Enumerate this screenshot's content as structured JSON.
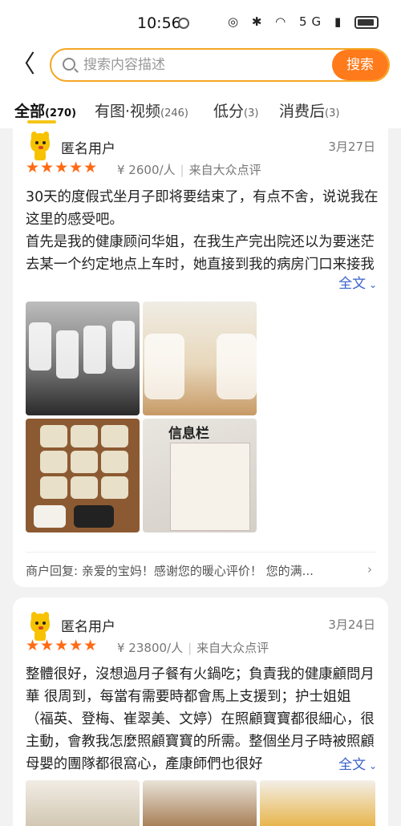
{
  "status": {
    "time": "10:56",
    "icons": "◎ ✱ ◠ 5G ▮"
  },
  "header": {
    "search_placeholder": "搜索内容描述",
    "search_button": "搜索",
    "back_glyph": "〈"
  },
  "tabs": [
    {
      "label": "全部",
      "count": "(270)"
    },
    {
      "label": "有图·视频",
      "count": "(246)"
    },
    {
      "label": "低分",
      "count": "(3)"
    },
    {
      "label": "消费后",
      "count": "(3)"
    }
  ],
  "reviews": [
    {
      "user": "匿名用户",
      "date": "3月27日",
      "stars": "★★★★★",
      "price": "¥ 2600/人",
      "source": "来自大众点评",
      "text": "30天的度假式坐月子即将要结束了，有点不舍，说说我在这里的感受吧。\n首先是我的健康顾问华姐，在我生产完出院还以为要迷茫去某一个约定地点上车时，她直接到我的病房门口来接我了，被惊喜到了。偶尔送餐来我房间还会给",
      "more": "全文",
      "photo_text": "信息栏",
      "reply": "商户回复: 亲爱的宝妈！感谢您的暖心评价！ 您的满..."
    },
    {
      "user": "匿名用户",
      "date": "3月24日",
      "stars": "★★★★★",
      "price": "¥ 23800/人",
      "source": "来自大众点评",
      "text": "整體很好，沒想過月子餐有火鍋吃；負責我的健康顧問月華 很周到，每當有需要時都會馬上支援到；护士姐姐（福英、登梅、崔翠美、文婷）在照顧寶寶都很細心，很主動，會教我怎麼照顧寶寶的所需。整個坐月子時被照顧母嬰的團隊都很窩心，產康師們也很好",
      "more": "全文"
    }
  ],
  "colors": {
    "accent": "#ff7a1a",
    "star": "#ff6a13",
    "link": "#3a63c8",
    "search_border": "#f5a623"
  }
}
